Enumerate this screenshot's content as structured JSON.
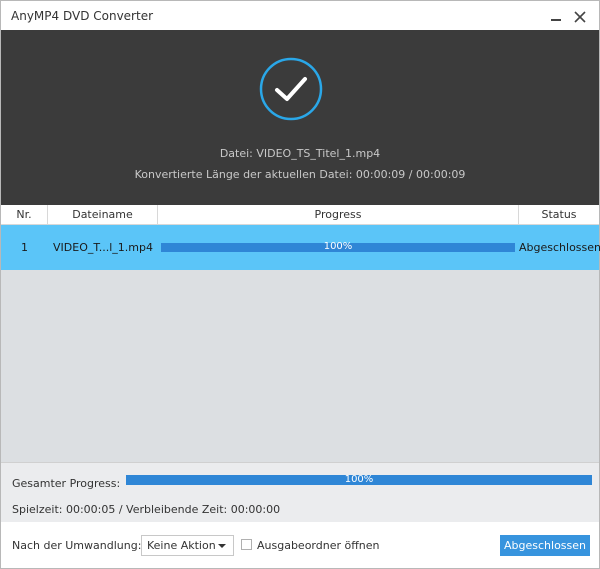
{
  "window": {
    "title": "AnyMP4 DVD Converter"
  },
  "hero": {
    "status_icon": "checkmark-circle-icon",
    "file_line": "Datei: VIDEO_TS_Titel_1.mp4",
    "length_line": "Konvertierte Länge der aktuellen Datei: 00:00:09 / 00:00:09"
  },
  "table": {
    "headers": {
      "nr": "Nr.",
      "name": "Dateiname",
      "progress": "Progress",
      "status": "Status"
    },
    "rows": [
      {
        "nr": "1",
        "name": "VIDEO_T...l_1.mp4",
        "progress": 1.0,
        "progress_label": "100%",
        "status": "Abgeschlossen"
      }
    ]
  },
  "summary": {
    "total_label": "Gesamter Progress:",
    "total_progress": 1.0,
    "total_progress_label": "100%",
    "time_line": "Spielzeit: 00:00:05 / Verbleibende Zeit: 00:00:00"
  },
  "footer": {
    "after_label": "Nach der Umwandlung:",
    "after_value": "Keine Aktion",
    "open_folder_label": "Ausgabeordner öffnen",
    "open_folder_checked": false,
    "done_button": "Abgeschlossen"
  },
  "colors": {
    "accent": "#3794de",
    "selected_row": "#5bc5f8",
    "progress": "#2f86d6",
    "hero_bg": "#3b3b3b",
    "check_ring": "#2aa7e8"
  }
}
